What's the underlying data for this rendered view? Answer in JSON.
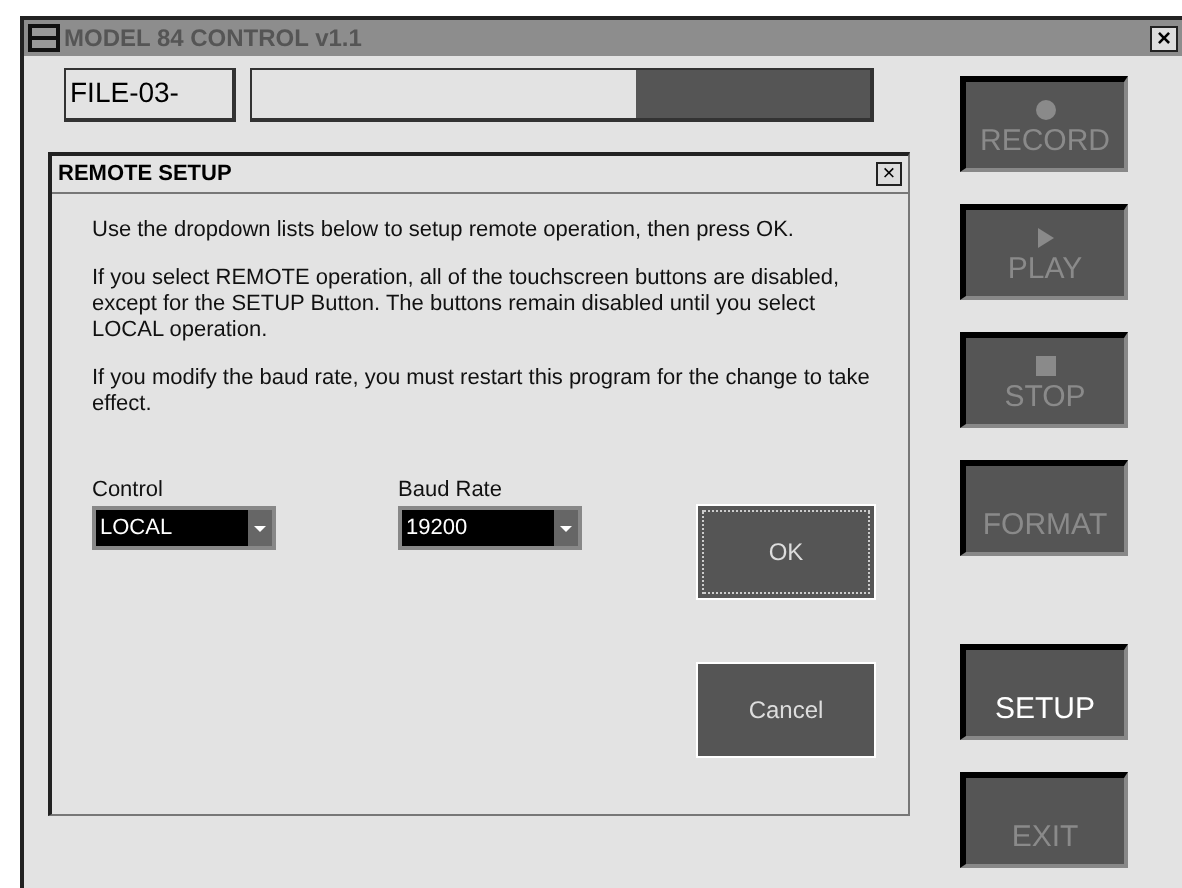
{
  "window": {
    "title": "MODEL 84 CONTROL v1.1",
    "close": "×"
  },
  "file": {
    "value": "FILE-03-"
  },
  "progress": {
    "level": 0.62
  },
  "side_buttons": [
    {
      "label": "RECORD",
      "kind": "record",
      "disabled": true
    },
    {
      "label": "PLAY",
      "kind": "play",
      "disabled": true
    },
    {
      "label": "STOP",
      "kind": "stop",
      "disabled": true
    },
    {
      "label": "FORMAT",
      "kind": "plain",
      "disabled": true
    },
    {
      "label": "SETUP",
      "kind": "plain",
      "disabled": false
    },
    {
      "label": "EXIT",
      "kind": "plain",
      "disabled": true
    }
  ],
  "dialog": {
    "title": "REMOTE SETUP",
    "close": "×",
    "paragraphs": [
      "Use the dropdown lists below to setup remote operation, then press OK.",
      "If you select REMOTE operation, all of the touchscreen buttons are disabled, except for the SETUP Button.  The buttons remain disabled until you select LOCAL operation.",
      "If you modify the baud rate, you must restart this program for the change to take effect."
    ],
    "dropdowns": [
      {
        "label": "Control",
        "value": "LOCAL"
      },
      {
        "label": "Baud Rate",
        "value": "19200"
      }
    ],
    "ok": "OK",
    "cancel": "Cancel"
  }
}
